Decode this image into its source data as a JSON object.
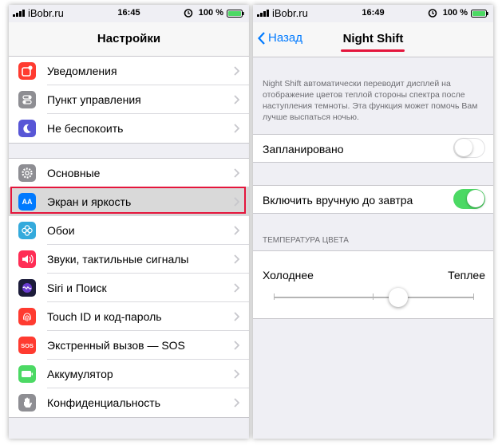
{
  "left_screen": {
    "status": {
      "carrier": "iBobr.ru",
      "time": "16:45",
      "battery": "100 %"
    },
    "title": "Настройки",
    "groups": [
      [
        {
          "label": "Уведомления",
          "icon": "notifications-icon",
          "color": "#ff3b30"
        },
        {
          "label": "Пункт управления",
          "icon": "control-center-icon",
          "color": "#8e8e93"
        },
        {
          "label": "Не беспокоить",
          "icon": "moon-icon",
          "color": "#5856d6"
        }
      ],
      [
        {
          "label": "Основные",
          "icon": "gear-icon",
          "color": "#8e8e93"
        },
        {
          "label": "Экран и яркость",
          "icon": "display-brightness-icon",
          "color": "#007aff",
          "icon_text": "AA",
          "highlighted": true
        },
        {
          "label": "Обои",
          "icon": "wallpaper-icon",
          "color": "#34aadc"
        },
        {
          "label": "Звуки, тактильные сигналы",
          "icon": "sound-icon",
          "color": "#ff2d55"
        },
        {
          "label": "Siri и Поиск",
          "icon": "siri-icon",
          "color": "#1c1c3a"
        },
        {
          "label": "Touch ID и код-пароль",
          "icon": "fingerprint-icon",
          "color": "#ff3b30"
        },
        {
          "label": "Экстренный вызов — SOS",
          "icon": "sos-icon",
          "color": "#ff3b30",
          "icon_text": "SOS"
        },
        {
          "label": "Аккумулятор",
          "icon": "battery-icon",
          "color": "#4cd964"
        },
        {
          "label": "Конфиденциальность",
          "icon": "hand-icon",
          "color": "#8e8e93"
        }
      ]
    ]
  },
  "right_screen": {
    "status": {
      "carrier": "iBobr.ru",
      "time": "16:49",
      "battery": "100 %"
    },
    "back_label": "Назад",
    "title": "Night Shift",
    "description": "Night Shift автоматически переводит дисплей на отображение цветов теплой стороны спектра после наступления темноты. Эта функция может помочь Вам лучше выспаться ночью.",
    "scheduled": {
      "label": "Запланировано",
      "on": false
    },
    "manual": {
      "label": "Включить вручную до завтра",
      "on": true
    },
    "temperature": {
      "header": "ТЕМПЕРАТУРА ЦВЕТА",
      "cold": "Холоднее",
      "warm": "Теплее",
      "value": 0.62
    }
  },
  "colors": {
    "accent": "#007aff",
    "highlight_red": "#e4163c",
    "switch_on": "#4cd964"
  }
}
